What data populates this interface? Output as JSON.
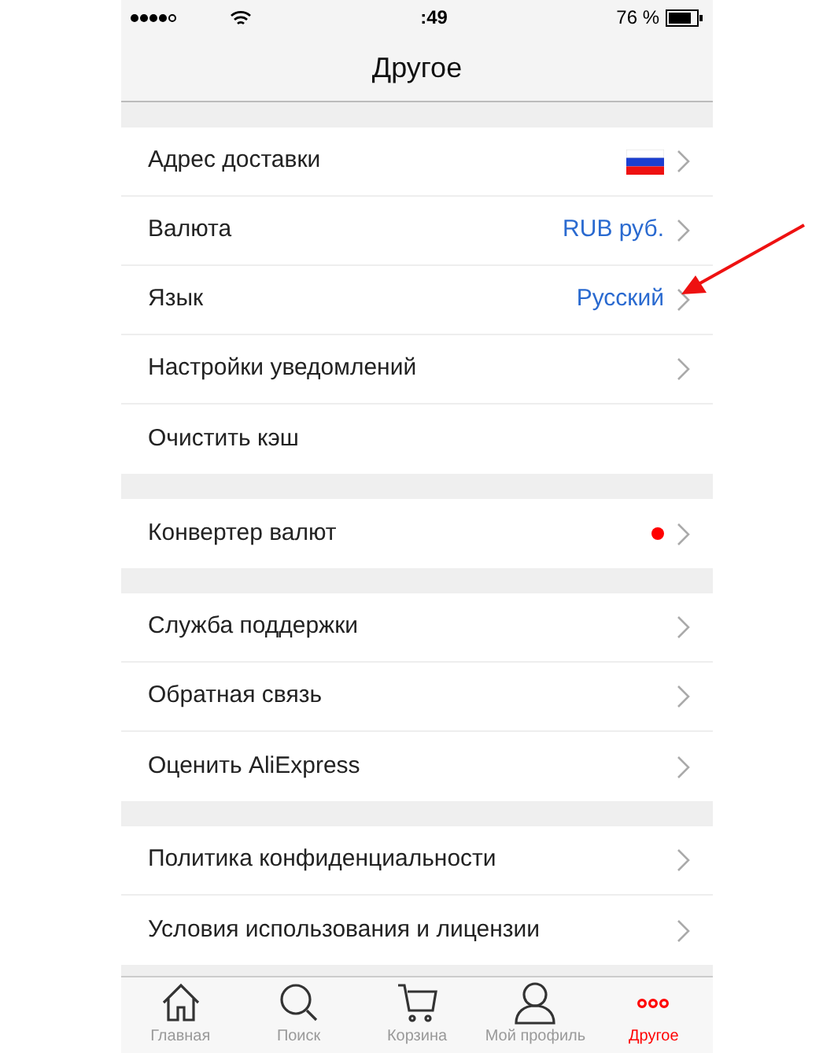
{
  "status_bar": {
    "time": ":49",
    "battery": "76 %"
  },
  "header": {
    "title": "Другое"
  },
  "sections": [
    {
      "rows": [
        {
          "label": "Адрес доставки",
          "kind": "flag",
          "chevron": true
        },
        {
          "label": "Валюта",
          "kind": "value",
          "value": "RUB руб.",
          "chevron": true
        },
        {
          "label": "Язык",
          "kind": "value",
          "value": "Русский",
          "chevron": true,
          "annotated": true
        },
        {
          "label": "Настройки уведомлений",
          "kind": "plain",
          "chevron": true
        },
        {
          "label": "Очистить кэш",
          "kind": "plain",
          "chevron": false
        }
      ]
    },
    {
      "rows": [
        {
          "label": "Конвертер валют",
          "kind": "dot",
          "color": "#ff0000",
          "chevron": true
        }
      ]
    },
    {
      "rows": [
        {
          "label": "Служба поддержки",
          "kind": "plain",
          "chevron": true
        },
        {
          "label": "Обратная связь",
          "kind": "plain",
          "chevron": true
        },
        {
          "label": "Оценить AliExpress",
          "kind": "plain",
          "chevron": true
        }
      ]
    },
    {
      "rows": [
        {
          "label": "Политика конфиденциальности",
          "kind": "plain",
          "chevron": true
        },
        {
          "label": "Условия использования и лицензии",
          "kind": "plain",
          "chevron": true
        }
      ]
    }
  ],
  "tab_bar": [
    {
      "label": "Главная",
      "selected": false
    },
    {
      "label": "Поиск",
      "selected": false
    },
    {
      "label": "Корзина",
      "selected": false
    },
    {
      "label": "Мой профиль",
      "selected": false
    },
    {
      "label": "Другое",
      "selected": true
    }
  ]
}
